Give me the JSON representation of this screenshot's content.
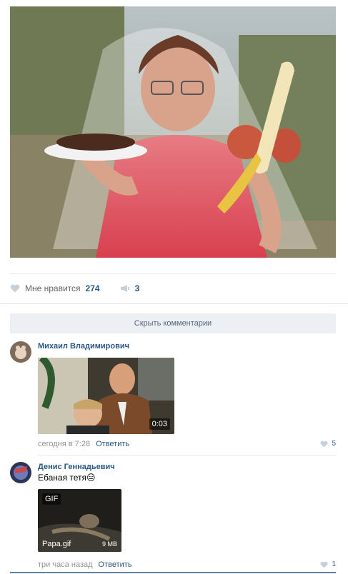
{
  "post": {
    "likes_label": "Мне нравится",
    "likes_count": "274",
    "shares_count": "3"
  },
  "comments_toggle": "Скрыть комментарии",
  "comments": [
    {
      "author": "Михаил Владимирович",
      "video_duration": "0:03",
      "time": "сегодня в 7:28",
      "reply_label": "Ответить",
      "likes": "5"
    },
    {
      "author": "Денис Геннадьевич",
      "text": "Ебаная тетя😑",
      "gif_badge": "GIF",
      "gif_name": "Papa.gif",
      "gif_size": "9 MB",
      "time": "три часа назад",
      "reply_label": "Ответить",
      "likes": "1"
    }
  ],
  "colors": {
    "link": "#2a5885",
    "muted": "#939393",
    "button_bg": "#eceff3",
    "divider": "#e7e8ec"
  },
  "icons": [
    "heart-icon",
    "megaphone-icon"
  ]
}
